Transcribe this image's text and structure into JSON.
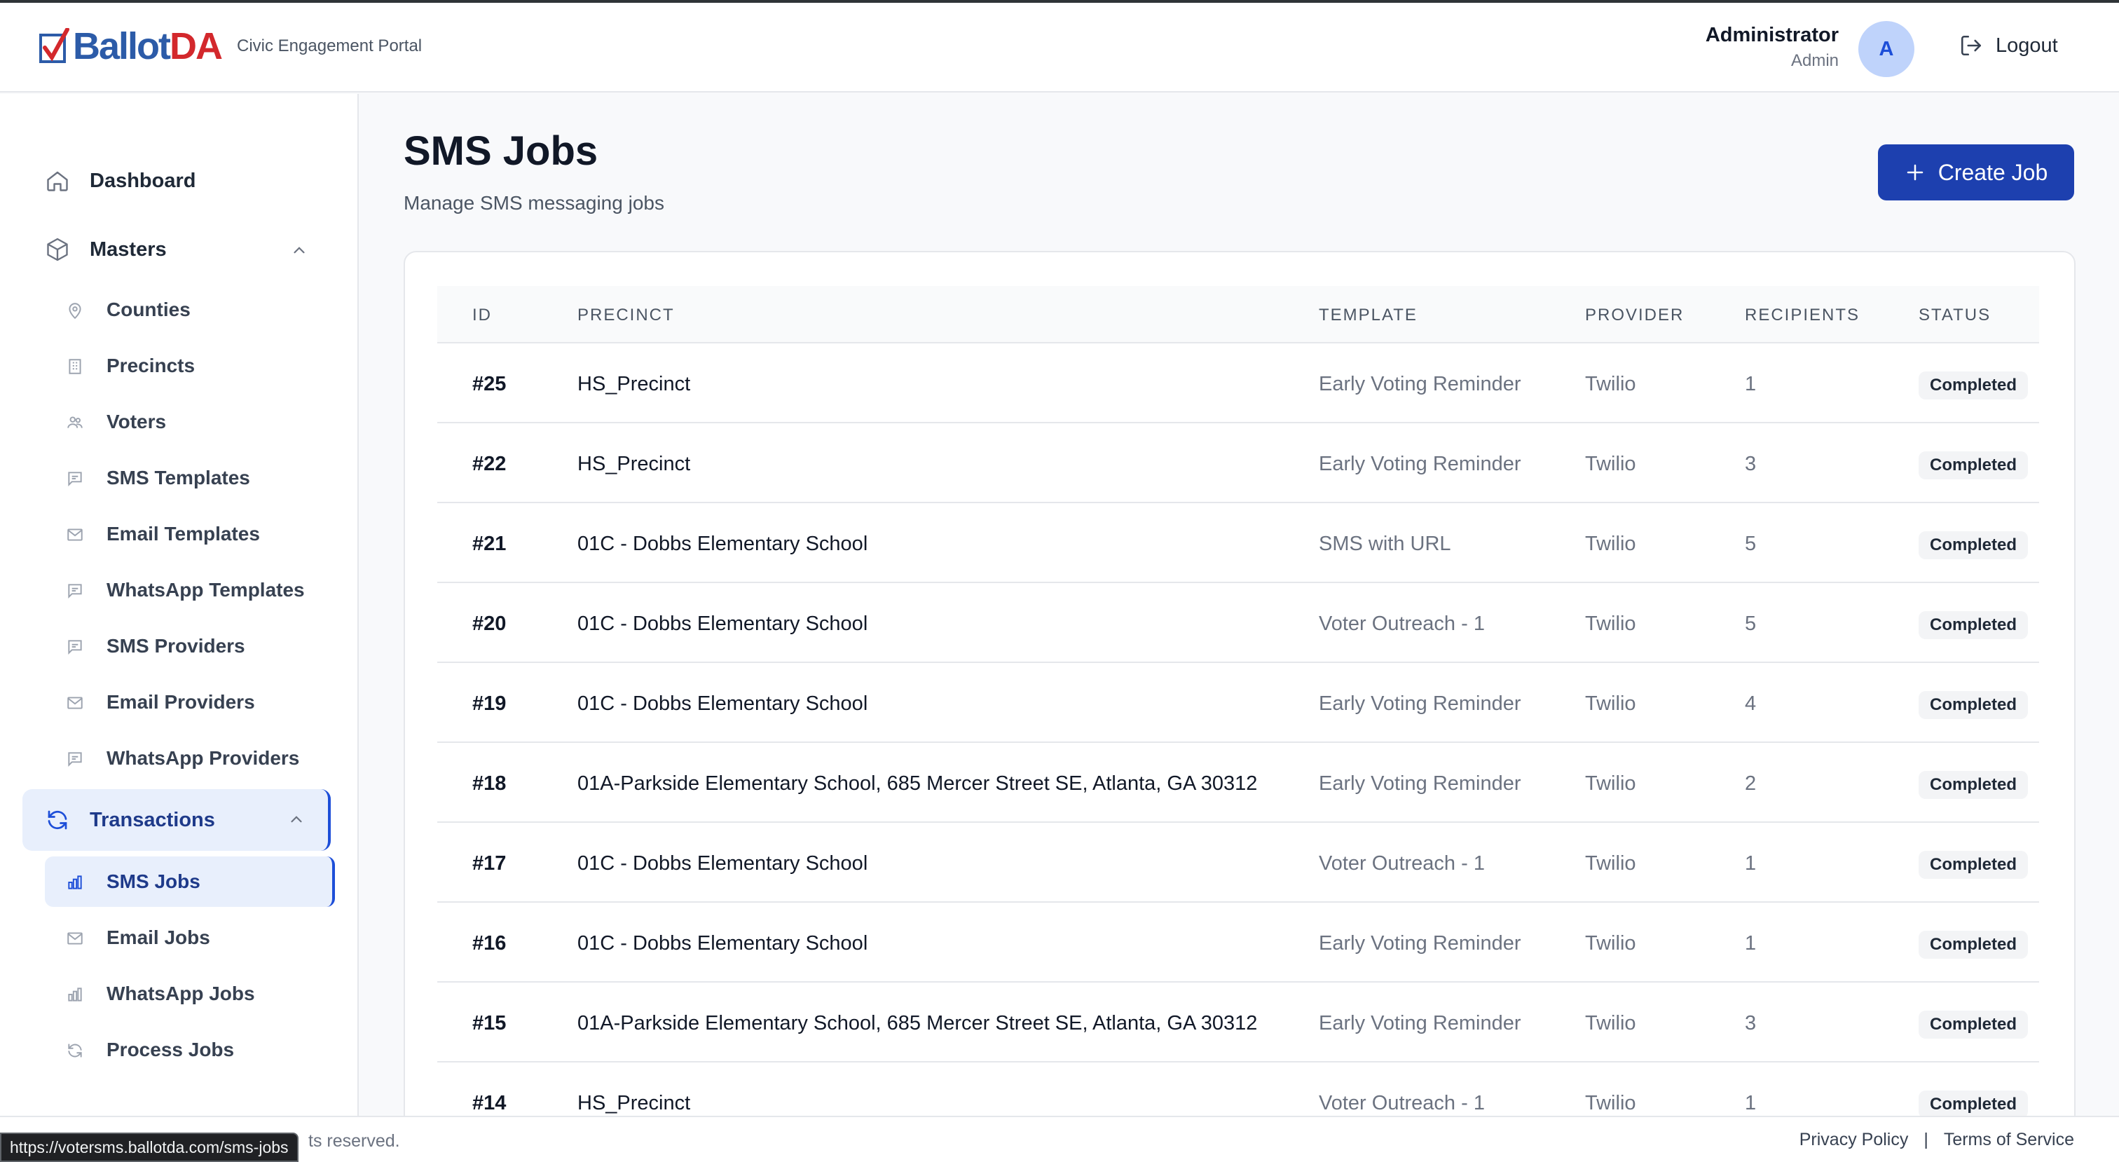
{
  "app": {
    "logo_text": "BallotDA",
    "tagline": "Civic Engagement Portal"
  },
  "header": {
    "user_name": "Administrator",
    "user_role": "Admin",
    "avatar_initial": "A",
    "logout_label": "Logout"
  },
  "sidebar": {
    "dashboard": "Dashboard",
    "masters": {
      "label": "Masters",
      "items": [
        "Counties",
        "Precincts",
        "Voters",
        "SMS Templates",
        "Email Templates",
        "WhatsApp Templates",
        "SMS Providers",
        "Email Providers",
        "WhatsApp Providers"
      ]
    },
    "transactions": {
      "label": "Transactions",
      "items": [
        "SMS Jobs",
        "Email Jobs",
        "WhatsApp Jobs",
        "Process Jobs"
      ]
    }
  },
  "main": {
    "title": "SMS Jobs",
    "subtitle": "Manage SMS messaging jobs",
    "create_button": "Create Job",
    "columns": [
      "ID",
      "PRECINCT",
      "TEMPLATE",
      "PROVIDER",
      "RECIPIENTS",
      "STATUS"
    ],
    "rows": [
      {
        "id": "#25",
        "precinct": "HS_Precinct",
        "template": "Early Voting Reminder",
        "provider": "Twilio",
        "recipients": "1",
        "status": "Completed"
      },
      {
        "id": "#22",
        "precinct": "HS_Precinct",
        "template": "Early Voting Reminder",
        "provider": "Twilio",
        "recipients": "3",
        "status": "Completed"
      },
      {
        "id": "#21",
        "precinct": "01C - Dobbs Elementary School",
        "template": "SMS with URL",
        "provider": "Twilio",
        "recipients": "5",
        "status": "Completed"
      },
      {
        "id": "#20",
        "precinct": "01C - Dobbs Elementary School",
        "template": "Voter Outreach - 1",
        "provider": "Twilio",
        "recipients": "5",
        "status": "Completed"
      },
      {
        "id": "#19",
        "precinct": "01C - Dobbs Elementary School",
        "template": "Early Voting Reminder",
        "provider": "Twilio",
        "recipients": "4",
        "status": "Completed"
      },
      {
        "id": "#18",
        "precinct": "01A-Parkside Elementary School, 685 Mercer Street SE, Atlanta, GA 30312",
        "template": "Early Voting Reminder",
        "provider": "Twilio",
        "recipients": "2",
        "status": "Completed"
      },
      {
        "id": "#17",
        "precinct": "01C - Dobbs Elementary School",
        "template": "Voter Outreach - 1",
        "provider": "Twilio",
        "recipients": "1",
        "status": "Completed"
      },
      {
        "id": "#16",
        "precinct": "01C - Dobbs Elementary School",
        "template": "Early Voting Reminder",
        "provider": "Twilio",
        "recipients": "1",
        "status": "Completed"
      },
      {
        "id": "#15",
        "precinct": "01A-Parkside Elementary School, 685 Mercer Street SE, Atlanta, GA 30312",
        "template": "Early Voting Reminder",
        "provider": "Twilio",
        "recipients": "3",
        "status": "Completed"
      },
      {
        "id": "#14",
        "precinct": "HS_Precinct",
        "template": "Voter Outreach - 1",
        "provider": "Twilio",
        "recipients": "1",
        "status": "Completed"
      }
    ]
  },
  "footer": {
    "copyright_visible": "ts reserved.",
    "privacy": "Privacy Policy",
    "separator": "|",
    "terms": "Terms of Service",
    "status_url": "https://votersms.ballotda.com/sms-jobs"
  },
  "colors": {
    "primary": "#1d40af",
    "active_bg": "#e8effc",
    "logo_blue": "#2c5ba8",
    "logo_red": "#d3282c"
  }
}
